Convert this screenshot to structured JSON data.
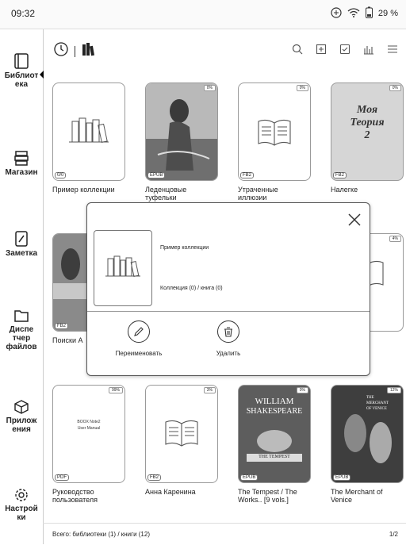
{
  "status": {
    "time": "09:32",
    "battery": "29 %"
  },
  "sidebar": {
    "items": [
      {
        "label": "Библиот\nека"
      },
      {
        "label": "Магазин"
      },
      {
        "label": "Заметка"
      },
      {
        "label": "Диспе\nтчер\nфайлов"
      },
      {
        "label": "Прилож\nения"
      },
      {
        "label": "Настрой\nки"
      }
    ]
  },
  "toolbar": {
    "left_icons": [
      "clock-icon",
      "bookshelf-icon"
    ],
    "right_icons": [
      "search-icon",
      "import-icon",
      "select-icon",
      "statistics-icon",
      "menu-icon"
    ]
  },
  "grid": {
    "tiles": [
      {
        "title": "Пример коллекции",
        "format": "0/0",
        "percent": "",
        "type": "collection"
      },
      {
        "title": "Леденцовые\nтуфельки",
        "format": "EPUB",
        "percent": "0%",
        "type": "cover-girl"
      },
      {
        "title": "Утраченные\nиллюзии",
        "format": "FB2",
        "percent": "0%",
        "type": "book-icon"
      },
      {
        "title": "Налегке",
        "format": "FB2",
        "percent": "0%",
        "type": "cover-old"
      },
      {
        "title": "Поиски А",
        "format": "FB2",
        "percent": "",
        "type": "cover-partial"
      },
      {
        "title": "",
        "format": "",
        "percent": "4%",
        "type": "book-icon-partial"
      },
      {
        "title": "Руководство\nпользователя",
        "format": "PDF",
        "percent": "99%",
        "type": "manual"
      },
      {
        "title": "Анна Каренина",
        "format": "FB2",
        "percent": "3%",
        "type": "book-icon"
      },
      {
        "title": "The Tempest / The\nWorks.. [9 vols.]",
        "format": "EPUB",
        "percent": "0%",
        "type": "tempest"
      },
      {
        "title": "The Merchant of\nVenice",
        "format": "EPUB",
        "percent": "12%",
        "type": "merchant"
      }
    ]
  },
  "cover_text": {
    "old": "Моя\nТеория\n2",
    "manual": "BOOX Note2\nUser Manual",
    "tempest_1": "WILLIAM",
    "tempest_2": "SHAKESPEARE",
    "tempest_3": "THE TEMPEST",
    "merchant": "THE\nMERCHANT\nOF VENICE"
  },
  "dialog": {
    "name": "Пример коллекции",
    "info": "Коллекция (0) / книга (0)",
    "rename_label": "Переименовать",
    "delete_label": "Удалить"
  },
  "footer": {
    "summary": "Всего: библиотеки (1) / книги (12)",
    "page": "1/2"
  }
}
